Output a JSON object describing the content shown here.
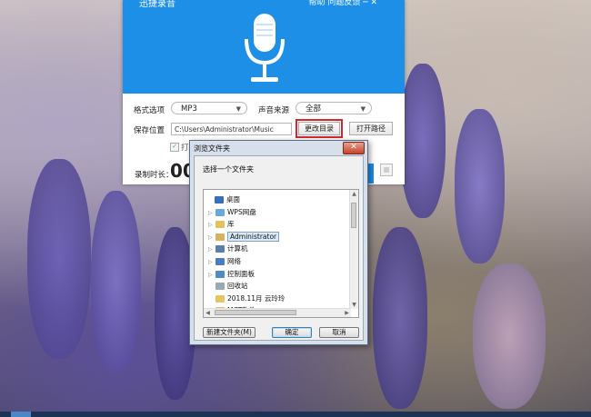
{
  "app": {
    "title": "迅捷录音",
    "header_links": "帮助   问题反馈   ─   ✕",
    "format_label": "格式选项",
    "format_value": "MP3",
    "source_label": "声音来源",
    "source_value": "全部",
    "save_label": "保存位置",
    "save_path": "C:\\Users\\Administrator\\Music",
    "change_dir_button": "更改目录",
    "open_path_button": "打开路径",
    "checkbox_label": "打",
    "record_label": "录制时长：",
    "record_time": "00",
    "accent_color": "#1e8fe6"
  },
  "dialog": {
    "title": "浏览文件夹",
    "close": "✕",
    "prompt": "选择一个文件夹",
    "tree": [
      {
        "label": "桌面",
        "icon": "desktop-icon",
        "color": "#3a6fb8",
        "expand": ""
      },
      {
        "label": "WPS网盘",
        "icon": "cloud-icon",
        "color": "#6aa7e0",
        "expand": "▷"
      },
      {
        "label": "库",
        "icon": "library-icon",
        "color": "#e6c15b",
        "expand": "▷"
      },
      {
        "label": "Administrator",
        "icon": "user-icon",
        "color": "#d9b25a",
        "expand": "▷",
        "selected": true
      },
      {
        "label": "计算机",
        "icon": "computer-icon",
        "color": "#5b7fa8",
        "expand": "▷"
      },
      {
        "label": "网络",
        "icon": "network-icon",
        "color": "#4a7cc1",
        "expand": "▷"
      },
      {
        "label": "控制面板",
        "icon": "control-panel-icon",
        "color": "#4f8dc6",
        "expand": "▷"
      },
      {
        "label": "回收站",
        "icon": "recycle-bin-icon",
        "color": "#9aa8b4",
        "expand": ""
      },
      {
        "label": "2018.11月 云玲玲",
        "icon": "folder-icon",
        "color": "#e8c35e",
        "expand": ""
      },
      {
        "label": "MCT软件",
        "icon": "folder-icon",
        "color": "#e8c35e",
        "expand": "▷"
      }
    ],
    "new_folder_button": "新建文件夹(M)",
    "ok_button": "确定",
    "cancel_button": "取消"
  }
}
